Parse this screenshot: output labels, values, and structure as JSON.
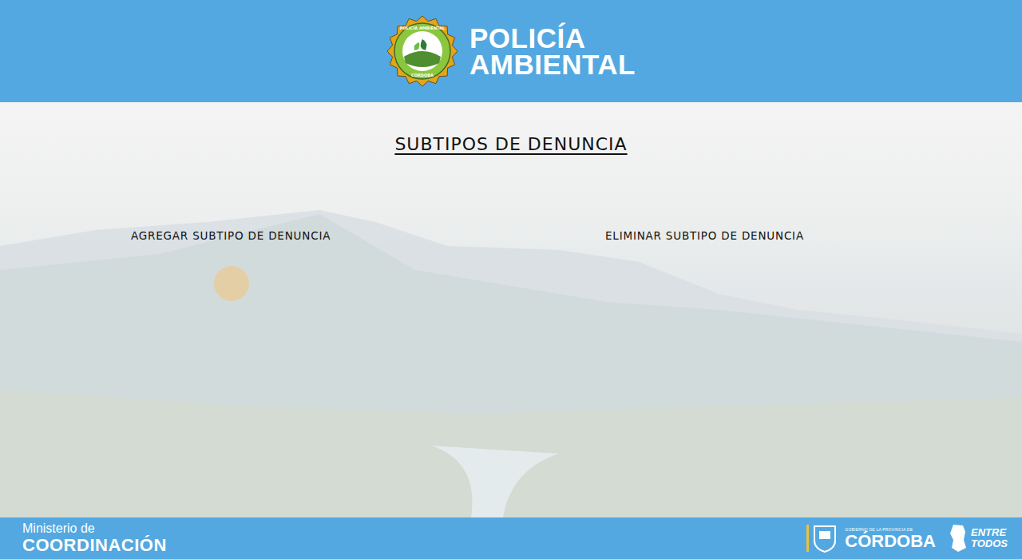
{
  "header": {
    "logo_title": "POLICÍA",
    "logo_subtitle": "AMBIENTAL",
    "badge_top": "POLICÍA AMBIENTAL",
    "badge_bottom": "CÓRDOBA"
  },
  "page": {
    "title": "SUBTIPOS DE DENUNCIA",
    "actions": [
      "AGREGAR SUBTIPO DE DENUNCIA",
      "ELIMINAR SUBTIPO DE DENUNCIA"
    ]
  },
  "footer": {
    "ministry_line1": "Ministerio de",
    "ministry_line2": "COORDINACIÓN",
    "gov_small": "GOBIERNO DE LA PROVINCIA DE",
    "gov_name": "CÓRDOBA",
    "slogan_line1": "ENTRE",
    "slogan_line2": "TODOS"
  }
}
